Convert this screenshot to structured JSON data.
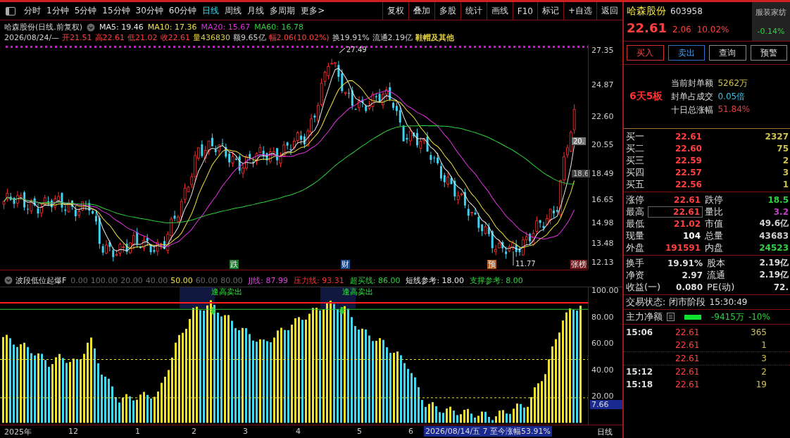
{
  "toolbar": {
    "periods": [
      {
        "label": "分时",
        "selected": false
      },
      {
        "label": "1分钟",
        "selected": false
      },
      {
        "label": "5分钟",
        "selected": false
      },
      {
        "label": "15分钟",
        "selected": false
      },
      {
        "label": "30分钟",
        "selected": false
      },
      {
        "label": "60分钟",
        "selected": false
      },
      {
        "label": "日线",
        "selected": true
      },
      {
        "label": "周线",
        "selected": false
      },
      {
        "label": "月线",
        "selected": false
      },
      {
        "label": "多周期",
        "selected": false
      },
      {
        "label": "更多>",
        "selected": false
      }
    ],
    "actions": [
      "复权",
      "叠加",
      "多股",
      "统计",
      "画线",
      "F10",
      "标记",
      "+自选",
      "返回"
    ]
  },
  "chart_header": {
    "title": "哈森股份(日线.前复权)",
    "ma": [
      {
        "text": "MA5: 19.46",
        "color": "#e8e8e8"
      },
      {
        "text": "MA10: 17.36",
        "color": "#f0e040"
      },
      {
        "text": "MA20: 15.67",
        "color": "#e030e0"
      },
      {
        "text": "MA60: 16.78",
        "color": "#30d040"
      }
    ],
    "quote": [
      {
        "text": "2026/08/24/—",
        "color": "#d0d0d0"
      },
      {
        "text": "开21.51",
        "color": "#ff4040"
      },
      {
        "text": "高22.61",
        "color": "#ff4040"
      },
      {
        "text": "低21.02",
        "color": "#ff4040"
      },
      {
        "text": "收22.61",
        "color": "#ff4040"
      },
      {
        "text": "量436830",
        "color": "#e0d040"
      },
      {
        "text": "额9.65亿",
        "color": "#d0d0d0"
      },
      {
        "text": "幅2.06(10.02%)",
        "color": "#ff4040"
      },
      {
        "text": "换19.91%",
        "color": "#d0d0d0"
      },
      {
        "text": "流通2.19亿",
        "color": "#d0d0d0"
      },
      {
        "text": "鞋帽及其他",
        "color": "#e0d040"
      }
    ]
  },
  "price_axis": [
    "27.35",
    "24.87",
    "22.60",
    "20.55",
    "18.49",
    "16.65",
    "14.98",
    "13.48",
    "12.13"
  ],
  "price_annotations": [
    "27.49",
    "11.77",
    "20.",
    "18.6"
  ],
  "events": [
    {
      "label": "跌",
      "color": "#1a7a2a"
    },
    {
      "label": "财",
      "color": "#1a4a8a"
    },
    {
      "label": "预",
      "color": "#b05a20"
    },
    {
      "label": "张榜",
      "color": "#7a1a1a"
    }
  ],
  "indicator": {
    "name": "波段低位起爆F",
    "params": [
      {
        "text": "0.00",
        "selected": false
      },
      {
        "text": "100.00",
        "selected": false
      },
      {
        "text": "20.00",
        "selected": false
      },
      {
        "text": "40.00",
        "selected": false
      },
      {
        "text": "50.00",
        "selected": true
      },
      {
        "text": "60.00",
        "selected": false
      },
      {
        "text": "80.00",
        "selected": false
      }
    ],
    "legend": [
      {
        "text": "JJ线: 87.99",
        "color": "#e040e0"
      },
      {
        "text": "压力线: 93.31",
        "color": "#ff3030"
      },
      {
        "text": "超买线: 86.00",
        "color": "#30d040"
      },
      {
        "text": "短线参考: 18.00",
        "color": "#e8e8e8"
      },
      {
        "text": "支撑参考: 8.00",
        "color": "#30d040"
      }
    ],
    "signals": [
      "逢高卖出",
      "逢高卖出"
    ],
    "axis": [
      "100.00",
      "80.00",
      "60.00",
      "40.00",
      "20.00"
    ],
    "current": "7.66"
  },
  "time_axis": [
    "2025年",
    "12",
    "1",
    "2",
    "3",
    "4",
    "5",
    "6"
  ],
  "range_label": "2026/08/14/五 7 至今涨幅53.91%",
  "period_label": "日线",
  "quote_panel": {
    "name": "哈森股份",
    "code": "603958",
    "sector": "服装家纺",
    "sector_change": "-0.14%",
    "price": "22.61",
    "change": "2.06",
    "change_pct": "10.02%",
    "buttons": [
      "买入",
      "卖出",
      "查询",
      "预警"
    ],
    "streak": "6天5板",
    "seal": [
      {
        "label": "当前封单额",
        "value": "5262万",
        "color": "#d0c050"
      },
      {
        "label": "封单占成交",
        "value": "0.05倍",
        "color": "#40c0e0"
      },
      {
        "label": "十日总涨幅",
        "value": "51.84%",
        "color": "#e04040"
      }
    ],
    "bids": [
      {
        "label": "买一",
        "price": "22.61",
        "volume": "2327"
      },
      {
        "label": "买二",
        "price": "22.60",
        "volume": "75"
      },
      {
        "label": "买三",
        "price": "22.59",
        "volume": "2"
      },
      {
        "label": "买四",
        "price": "22.57",
        "volume": "3"
      },
      {
        "label": "买五",
        "price": "22.56",
        "volume": "1"
      }
    ],
    "stats": [
      {
        "label": "涨停",
        "value": "22.61",
        "color": "#ff4040"
      },
      {
        "label": "跌停",
        "value": "18.5",
        "color": "#30d040"
      },
      {
        "label": "最高",
        "value": "22.61",
        "color": "#ff4040"
      },
      {
        "label": "量比",
        "value": "3.2",
        "color": "#c040c0"
      },
      {
        "label": "最低",
        "value": "21.02",
        "color": "#ff4040"
      },
      {
        "label": "市值",
        "value": "49.6亿",
        "color": "#d0d0d0"
      },
      {
        "label": "现量",
        "value": "104",
        "color": "#ffffff"
      },
      {
        "label": "总量",
        "value": "43683",
        "color": "#d0d0d0"
      },
      {
        "label": "外盘",
        "value": "191591",
        "color": "#ff4040"
      },
      {
        "label": "内盘",
        "value": "24523",
        "color": "#30d040"
      }
    ],
    "finance": [
      {
        "label": "换手",
        "value": "19.91%",
        "label2": "股本",
        "value2": "2.19亿"
      },
      {
        "label": "净资",
        "value": "2.97",
        "label2": "流通",
        "value2": "2.19亿"
      },
      {
        "label": "收益(一)",
        "value": "0.080",
        "label2": "PE(动)",
        "value2": "72."
      }
    ],
    "status": "交易状态: 闭市阶段",
    "status_time": "15:30:49",
    "flow_label": "主力净额",
    "flow_value": "-9415万",
    "flow_pct": "-10%",
    "trades": [
      {
        "time": "15:06",
        "price": "22.61",
        "volume": "365"
      },
      {
        "price": "22.61",
        "volume": "1"
      },
      {
        "price": "22.61",
        "volume": "3"
      },
      {
        "time": "15:12",
        "price": "22.61",
        "volume": "2"
      },
      {
        "time": "15:18",
        "price": "22.61",
        "volume": "19"
      }
    ]
  }
}
